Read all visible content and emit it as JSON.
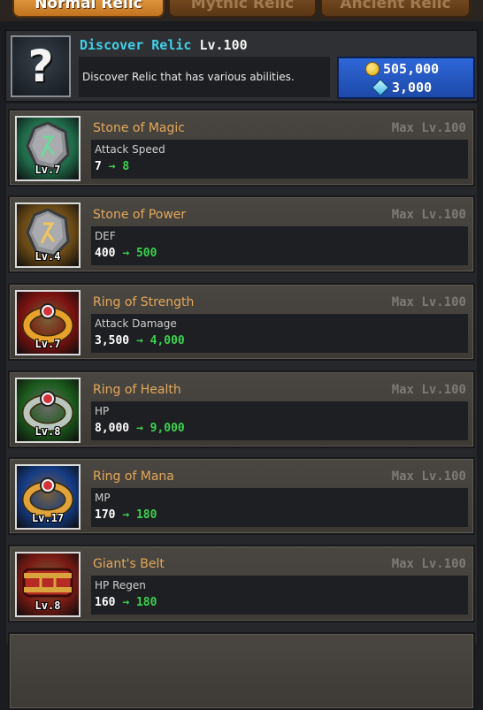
{
  "tabs": [
    {
      "label": "Normal Relic",
      "active": true
    },
    {
      "label": "Mythic Relic",
      "active": false
    },
    {
      "label": "Ancient Relic",
      "active": false
    }
  ],
  "discover": {
    "title": "Discover Relic",
    "level": "Lv.100",
    "description": "Discover Relic that has various abilities.",
    "icon": "?",
    "gold_cost": "505,000",
    "gem_cost": "3,000"
  },
  "relics": [
    {
      "name": "Stone of Magic",
      "level": "Lv.7",
      "max_level": "Max Lv.100",
      "stat": "Attack Speed",
      "from": "7",
      "to": "8",
      "theme": "#1f6b4a",
      "accent": "#6fd89b",
      "icon": "rune-stone-icon"
    },
    {
      "name": "Stone of Power",
      "level": "Lv.4",
      "max_level": "Max Lv.100",
      "stat": "DEF",
      "from": "400",
      "to": "500",
      "theme": "#6a4a16",
      "accent": "#f1c55b",
      "icon": "rune-stone-icon"
    },
    {
      "name": "Ring of Strength",
      "level": "Lv.7",
      "max_level": "Max Lv.100",
      "stat": "Attack Damage",
      "from": "3,500",
      "to": "4,000",
      "theme": "#7a1210",
      "accent": "#e8a12a",
      "icon": "ring-icon"
    },
    {
      "name": "Ring of Health",
      "level": "Lv.8",
      "max_level": "Max Lv.100",
      "stat": "HP",
      "from": "8,000",
      "to": "9,000",
      "theme": "#1b5a1c",
      "accent": "#b9c6bd",
      "icon": "ring-icon"
    },
    {
      "name": "Ring of Mana",
      "level": "Lv.17",
      "max_level": "Max Lv.100",
      "stat": "MP",
      "from": "170",
      "to": "180",
      "theme": "#143c86",
      "accent": "#e0a23a",
      "icon": "ring-icon"
    },
    {
      "name": "Giant's Belt",
      "level": "Lv.8",
      "max_level": "Max Lv.100",
      "stat": "HP Regen",
      "from": "160",
      "to": "180",
      "theme": "#7a1a14",
      "accent": "#d9a33d",
      "icon": "belt-icon"
    }
  ],
  "arrow_symbol": "→"
}
